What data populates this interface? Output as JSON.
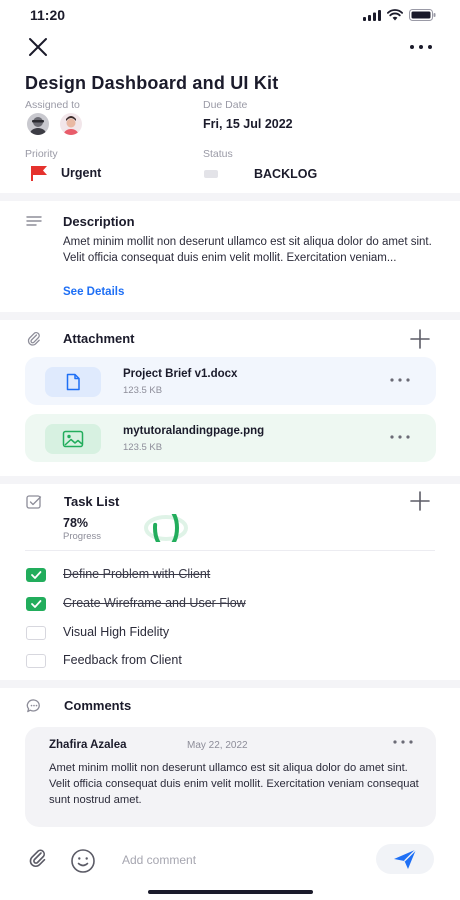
{
  "status_bar": {
    "time": "11:20"
  },
  "task": {
    "title": "Design Dashboard and UI Kit",
    "assigned_label": "Assigned to",
    "due_label": "Due Date",
    "due_value": "Fri, 15 Jul 2022",
    "priority_label": "Priority",
    "priority_value": "Urgent",
    "status_label": "Status",
    "status_value": "BACKLOG"
  },
  "description": {
    "title": "Description",
    "text": "Amet minim mollit non deserunt ullamco est sit aliqua dolor do amet sint. Velit officia consequat duis enim velit mollit. Exercitation veniam...",
    "see_details": "See Details"
  },
  "attachments": {
    "title": "Attachment",
    "items": [
      {
        "name": "Project Brief v1.docx",
        "size": "123.5 KB",
        "icon": "document-icon",
        "color": "#e6f0fd"
      },
      {
        "name": "mytutoralandingpage.png",
        "size": "123.5 KB",
        "icon": "image-icon",
        "color": "#e5f6ec"
      }
    ]
  },
  "tasks": {
    "title": "Task List",
    "progress_value": "78%",
    "progress_label": "Progress",
    "progress_fraction": 0.78,
    "items": [
      {
        "label": "Define Problem with Client",
        "done": true
      },
      {
        "label": "Create Wireframe and User Flow",
        "done": true
      },
      {
        "label": "Visual High Fidelity",
        "done": false
      },
      {
        "label": "Feedback from Client",
        "done": false
      }
    ]
  },
  "comments": {
    "title": "Comments",
    "items": [
      {
        "author": "Zhafira Azalea",
        "date": "May 22, 2022",
        "text": "Amet minim mollit non deserunt ullamco est sit aliqua dolor do amet sint. Velit officia consequat duis enim velit mollit. Exercitation veniam consequat sunt nostrud amet."
      }
    ],
    "composer_placeholder": "Add comment"
  },
  "colors": {
    "accent_blue": "#1e6ff5",
    "accent_green": "#22ad5c",
    "urgent_red": "#e5322d"
  }
}
